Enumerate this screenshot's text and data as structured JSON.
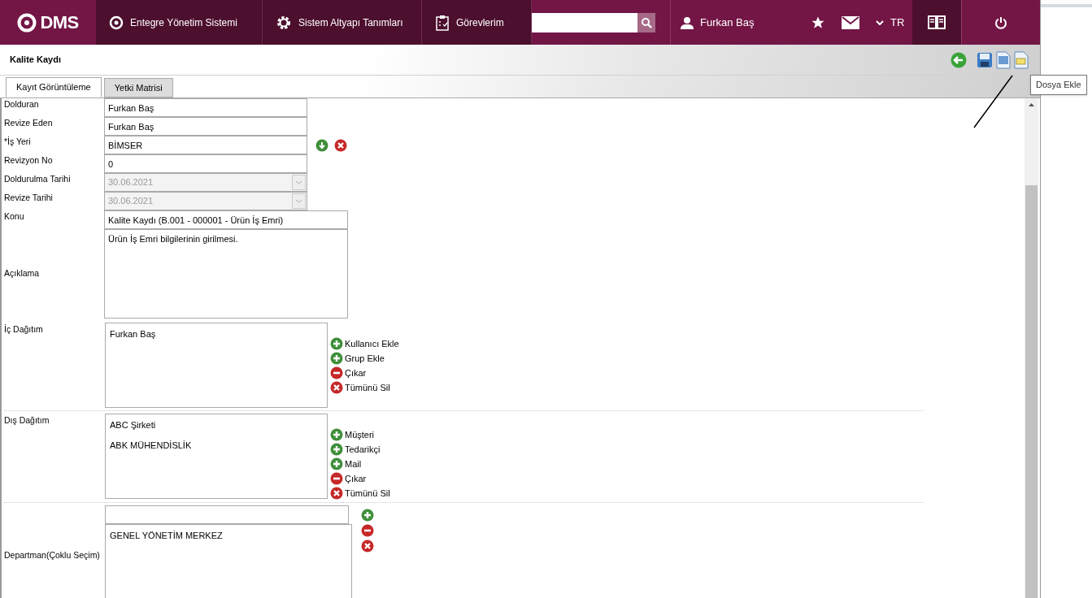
{
  "header": {
    "logo": "DMS",
    "nav": [
      {
        "label": "Entegre Yönetim Sistemi",
        "kind": "q"
      },
      {
        "label": "Sistem Altyapı Tanımları",
        "kind": "gear"
      },
      {
        "label": "Görevlerim",
        "kind": "clipboard"
      }
    ],
    "user": "Furkan Baş",
    "language": "TR"
  },
  "page_title": "Kalite Kaydı",
  "tooltip": "Dosya Ekle",
  "tabs": [
    {
      "label": "Kayıt Görüntüleme",
      "selected": true
    },
    {
      "label": "Yetki Matrisi",
      "selected": false
    }
  ],
  "fields": [
    {
      "kind": "text",
      "label": "Dolduran",
      "value": "Furkan Baş"
    },
    {
      "kind": "text",
      "label": "Revize Eden",
      "value": "Furkan Baş"
    },
    {
      "kind": "lookup",
      "label": "*İş Yeri",
      "value": "BİMSER"
    },
    {
      "kind": "text",
      "label": "Revizyon No",
      "value": "0"
    },
    {
      "kind": "date",
      "label": "Doldurulma Tarihi",
      "value": "30.06.2021",
      "disabled": true
    },
    {
      "kind": "date",
      "label": "Revize Tarihi",
      "value": "30.06.2021",
      "disabled": true
    },
    {
      "kind": "wide",
      "label": "Konu",
      "value": "Kalite Kaydı (B.001 - 000001 - Ürün İş Emri)"
    },
    {
      "kind": "textarea",
      "label": "Açıklama",
      "value": "Ürün İş Emri bilgilerinin girilmesi."
    },
    {
      "kind": "list",
      "label": "İç Dağıtım",
      "items": [
        "Furkan Baş"
      ],
      "actions": [
        {
          "kind": "add",
          "label": "Kullanıcı Ekle"
        },
        {
          "kind": "add",
          "label": "Grup Ekle"
        },
        {
          "kind": "remove",
          "label": "Çıkar"
        },
        {
          "kind": "clear",
          "label": "Tümünü Sil"
        }
      ]
    },
    {
      "kind": "list",
      "label": "Dış Dağıtım",
      "items": [
        "ABC Şirketi",
        "ABK MÜHENDİSLİK"
      ],
      "actions": [
        {
          "kind": "add",
          "label": "Müşteri"
        },
        {
          "kind": "add",
          "label": "Tedarikçi"
        },
        {
          "kind": "add",
          "label": "Mail"
        },
        {
          "kind": "remove",
          "label": "Çıkar"
        },
        {
          "kind": "clear",
          "label": "Tümünü Sil"
        }
      ]
    },
    {
      "kind": "multi",
      "label": "Departman(Çoklu Seçim)",
      "items": [
        "GENEL YÖNETİM MERKEZ"
      ],
      "actions": [
        {
          "kind": "add"
        },
        {
          "kind": "remove"
        },
        {
          "kind": "clear"
        }
      ]
    }
  ]
}
